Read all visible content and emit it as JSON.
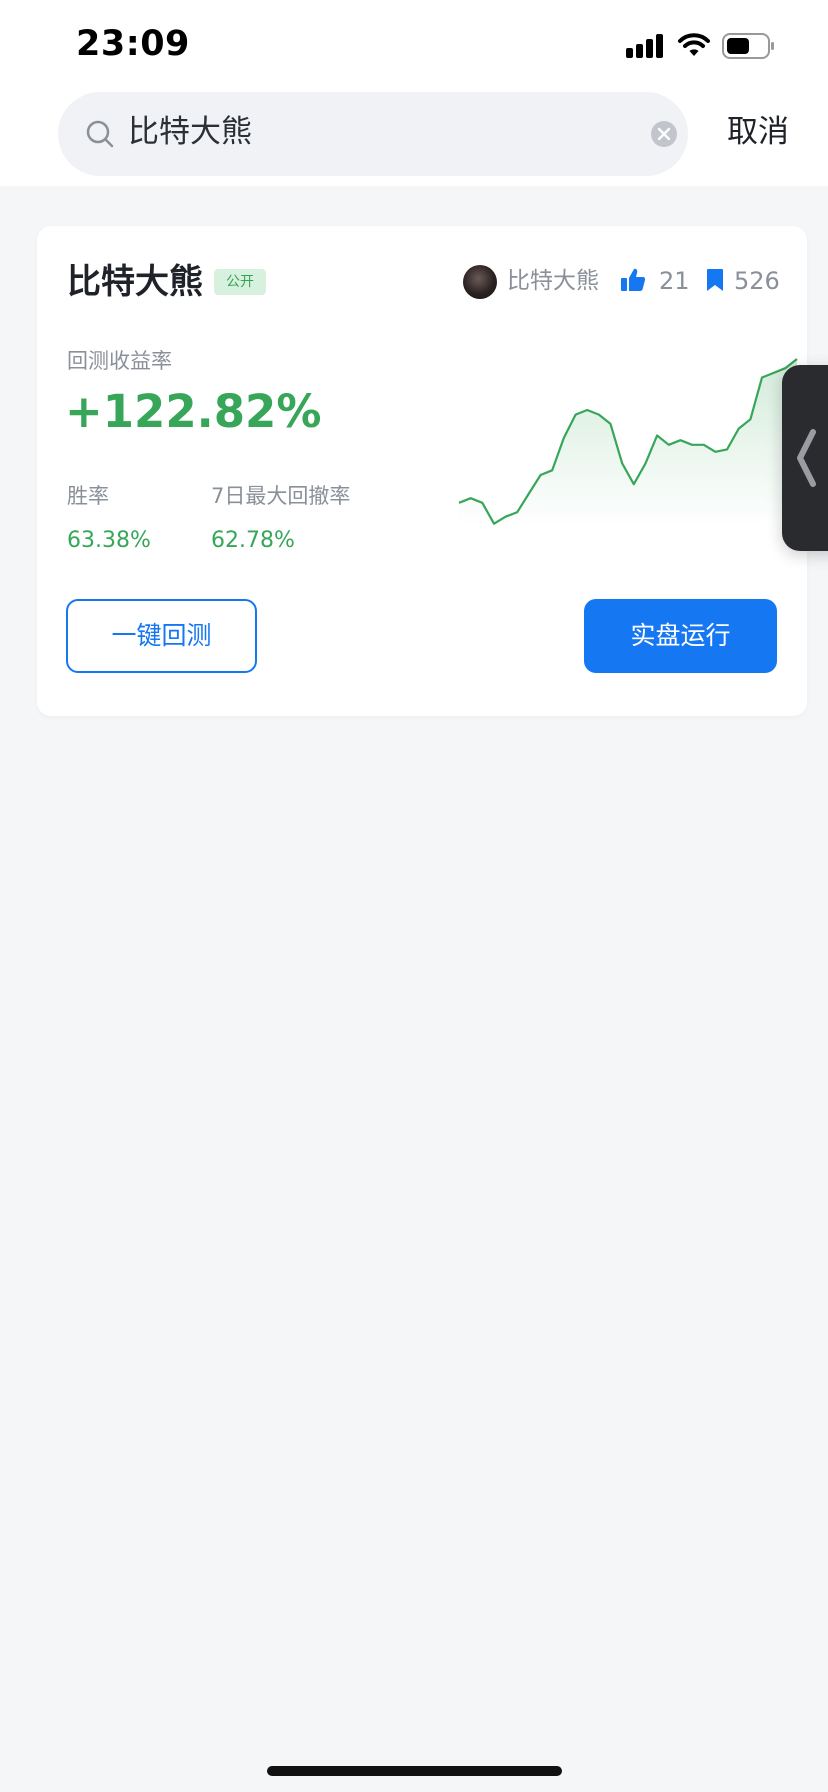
{
  "status_bar": {
    "time": "23:09"
  },
  "search": {
    "query": "比特大熊",
    "cancel_label": "取消"
  },
  "card": {
    "title": "比特大熊",
    "badge": "公开",
    "author": "比特大熊",
    "likes": "21",
    "bookmarks": "526",
    "return_label": "回测收益率",
    "return_value": "+122.82%",
    "win_rate_label": "胜率",
    "win_rate_value": "63.38%",
    "drawdown_label": "7日最大回撤率",
    "drawdown_value": "62.78%",
    "backtest_button": "一键回测",
    "live_button": "实盘运行",
    "accent_color": "#1677f2",
    "positive_color": "#37a659"
  },
  "chart_data": {
    "type": "line",
    "title": "",
    "xlabel": "",
    "ylabel": "",
    "grid": false,
    "legend": "none",
    "ylim": [
      0,
      100
    ],
    "series": [
      {
        "values": [
          10,
          12,
          10,
          1,
          4,
          6,
          14,
          22,
          24,
          38,
          48,
          50,
          48,
          44,
          27,
          18,
          27,
          39,
          35,
          37,
          35,
          35,
          32,
          33,
          42,
          46,
          64,
          66,
          68,
          72
        ]
      }
    ]
  }
}
